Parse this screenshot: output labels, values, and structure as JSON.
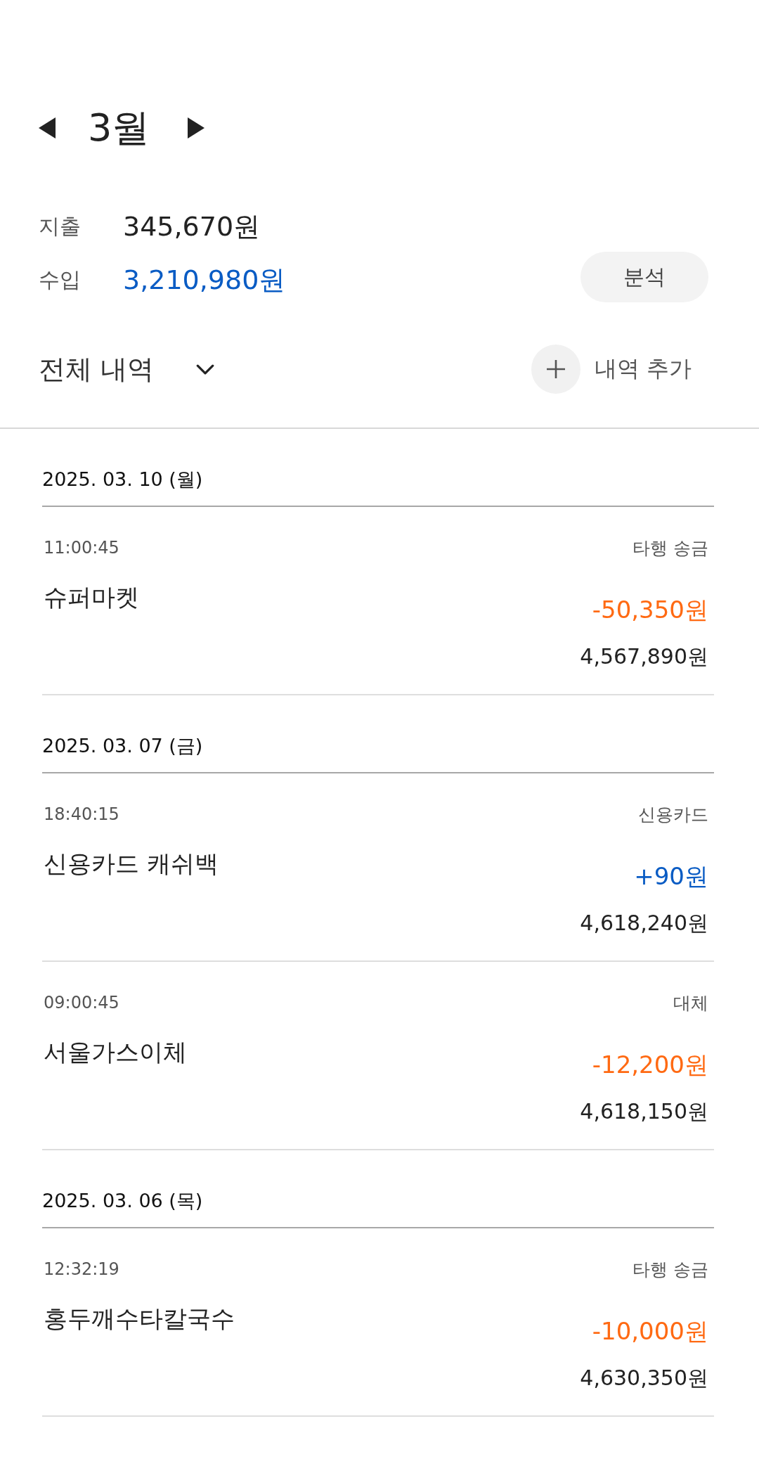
{
  "month": {
    "title": "3월"
  },
  "summary": [
    {
      "kind": "expense",
      "label": "지출",
      "value": "345,670원"
    },
    {
      "kind": "income",
      "label": "수입",
      "value": "3,210,980원"
    }
  ],
  "analyze_button": "분석",
  "filter": {
    "label": "전체 내역"
  },
  "add_button": "내역 추가",
  "days": [
    {
      "date": "2025. 03. 10 (월)",
      "transactions": [
        {
          "time": "11:00:45",
          "category": "타행 송금",
          "name": "슈퍼마켓",
          "kind": "expense",
          "amount": "-50,350원",
          "balance": "4,567,890원"
        }
      ]
    },
    {
      "date": "2025. 03. 07 (금)",
      "transactions": [
        {
          "time": "18:40:15",
          "category": "신용카드",
          "name": "신용카드 캐쉬백",
          "kind": "income",
          "amount": "+90원",
          "balance": "4,618,240원"
        },
        {
          "time": "09:00:45",
          "category": "대체",
          "name": "서울가스이체",
          "kind": "expense",
          "amount": "-12,200원",
          "balance": "4,618,150원"
        }
      ]
    },
    {
      "date": "2025. 03. 06 (목)",
      "transactions": [
        {
          "time": "12:32:19",
          "category": "타행 송금",
          "name": "홍두깨수타칼국수",
          "kind": "expense",
          "amount": "-10,000원",
          "balance": "4,630,350원"
        }
      ]
    }
  ]
}
